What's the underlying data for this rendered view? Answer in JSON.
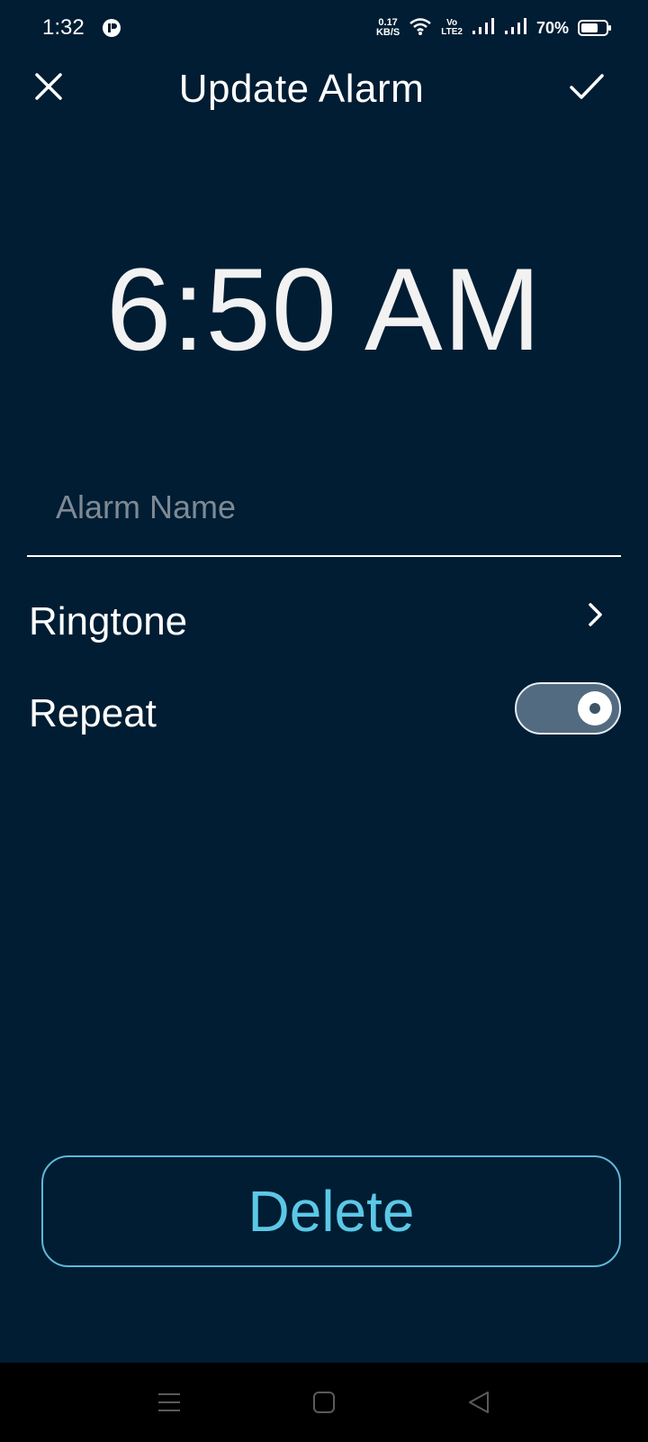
{
  "status_bar": {
    "time": "1:32",
    "net_speed_value": "0.17",
    "net_speed_unit": "KB/S",
    "volte_top": "Vo",
    "volte_bottom": "LTE2",
    "battery_percent": "70%",
    "battery_level": 0.7
  },
  "header": {
    "title": "Update Alarm"
  },
  "alarm": {
    "time": "6:50 AM",
    "name_placeholder": "Alarm Name",
    "name_value": ""
  },
  "settings": {
    "ringtone_label": "Ringtone",
    "repeat_label": "Repeat",
    "repeat_enabled": true
  },
  "actions": {
    "delete_label": "Delete"
  },
  "colors": {
    "background": "#001d33",
    "accent": "#5bc8e6",
    "toggle_track": "#536b80",
    "nav_bar": "#000000"
  }
}
